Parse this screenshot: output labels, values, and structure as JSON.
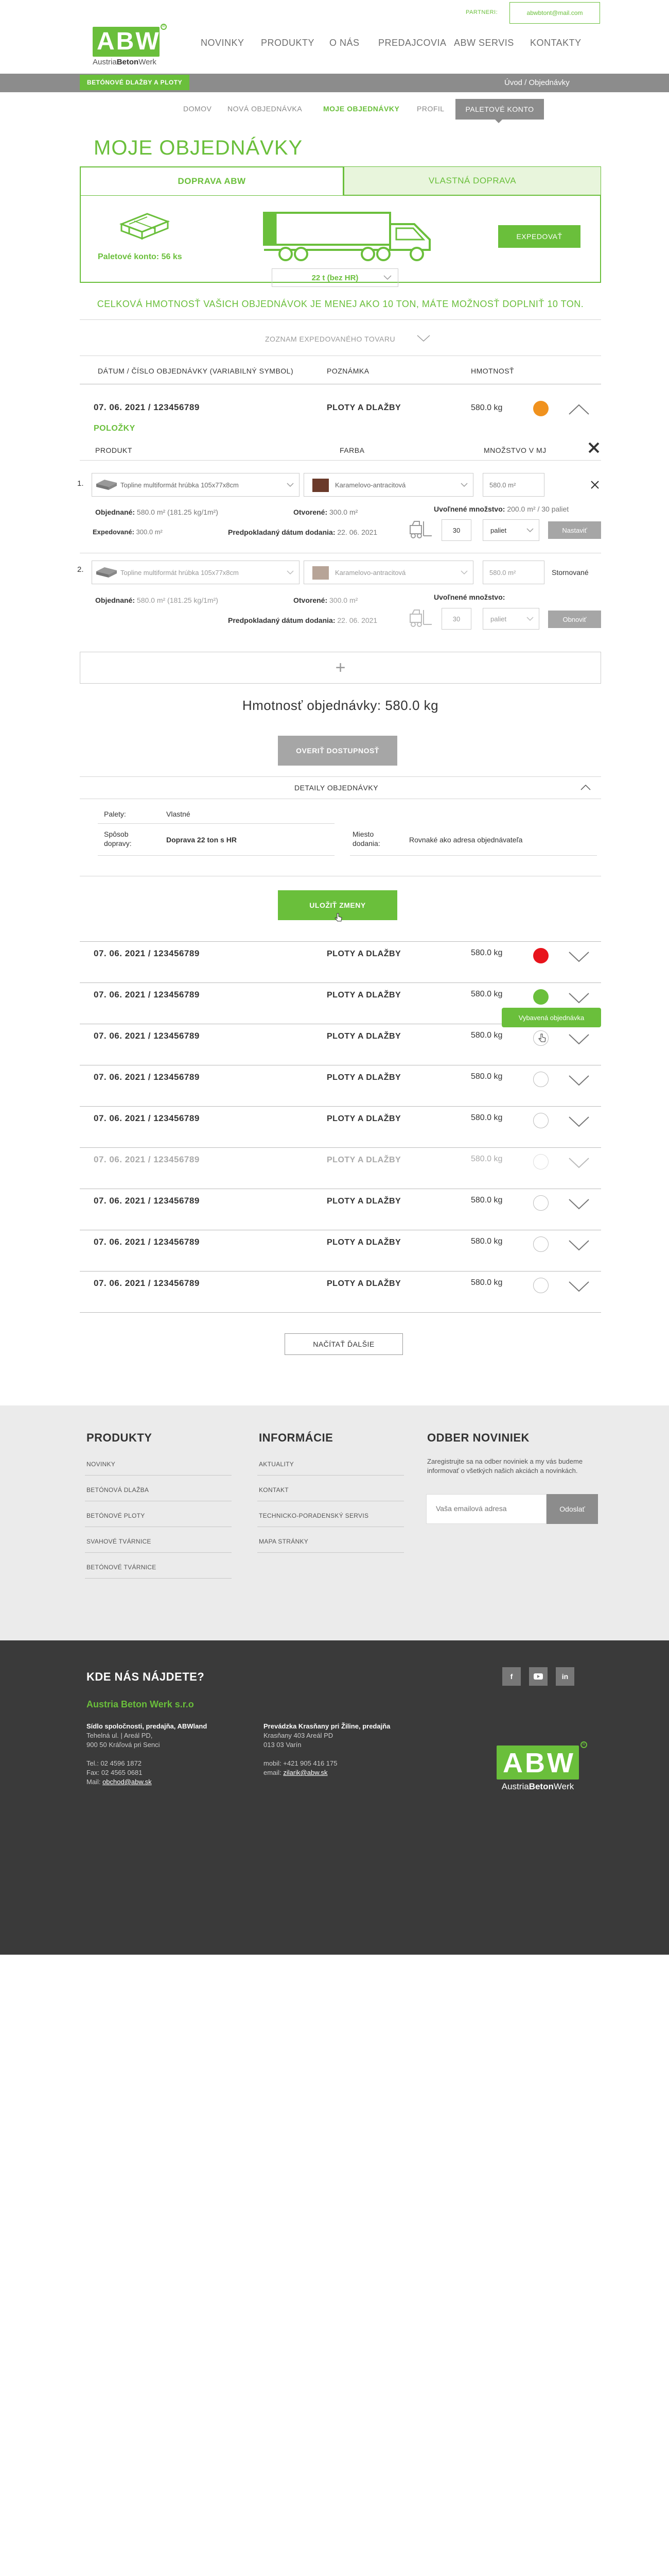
{
  "header": {
    "partner_label": "PARTNERI:",
    "email": "abwbtont@mail.com",
    "logo_text": "ABW",
    "logo_sub_prefix": "Austria",
    "logo_sub_bold": "Beton",
    "logo_sub_suffix": "Werk",
    "nav": [
      "NOVINKY",
      "PRODUKTY",
      "O NÁS",
      "PREDAJCOVIA",
      "ABW SERVIS",
      "KONTAKTY"
    ],
    "breadcrumb_badge": "BETÓNOVÉ DLAŽBY A PLOTY",
    "breadcrumb_right": "Úvod  /  Objednávky"
  },
  "subnav": {
    "items": [
      "DOMOV",
      "NOVÁ OBJEDNÁVKA",
      "MOJE OBJEDNÁVKY",
      "PROFIL"
    ],
    "active_index": 2,
    "button": "PALETOVÉ KONTO"
  },
  "page_title": "MOJE OBJEDNÁVKY",
  "tabs": [
    "DOPRAVA ABW",
    "VLASTNÁ DOPRAVA"
  ],
  "panel": {
    "pallet_label": "Paletové konto: 56 ks",
    "truck_select": "22 t (bez HR)",
    "truck_fill_fraction": 0.1,
    "expedite_button": "EXPEDOVAŤ"
  },
  "info_line": "CELKOVÁ HMOTNOSŤ VAŠICH OBJEDNÁVOK JE MENEJ AKO 10 TON, MÁTE MOŽNOSŤ DOPLNIŤ 10 TON.",
  "expedited_link": "ZOZNAM EXPEDOVANÉHO TOVARU",
  "table_headers": [
    "DÁTUM / ČÍSLO OBJEDNÁVKY (VARIABILNÝ SYMBOL)",
    "POZNÁMKA",
    "HMOTNOSŤ"
  ],
  "expanded_order": {
    "date": "07. 06. 2021 / 123456789",
    "type": "PLOTY A DLAŽBY",
    "weight": "580.0 kg",
    "status_color": "#f0921e",
    "items_label": "POLOŽKY",
    "item_headers": [
      "PRODUKT",
      "FARBA",
      "MNOŽSTVO V MJ"
    ],
    "items": [
      {
        "num": "1.",
        "product": "Topline multiformát hrúbka 105x77x8cm",
        "color_name": "Karamelovo-antracitová",
        "swatch": "#6b3a2a",
        "quantity": "580.0 m²",
        "ordered_label": "Objednané:",
        "ordered_value": "580.0 m² (181.25 kg/1m²)",
        "opened_label": "Otvorené:",
        "opened_value": "300.0 m²",
        "released_label": "Uvoľnené množstvo:",
        "released_value": "200.0 m² / 30 paliet",
        "expedited_label": "Expedované:",
        "expedited_value": "300.0 m²",
        "delivery_label": "Predpokladaný dátum dodania:",
        "delivery_value": "22. 06. 2021",
        "pallet_count": "30",
        "pallet_unit": "paliet",
        "action": "Nastaviť"
      },
      {
        "num": "2.",
        "product": "Topline multiformát hrúbka 105x77x8cm",
        "color_name": "Karamelovo-antracitová",
        "swatch": "#b7a497",
        "quantity": "580.0 m²",
        "status": "Stornované",
        "ordered_label": "Objednané:",
        "ordered_value": "580.0 m² (181.25 kg/1m²)",
        "opened_label": "Otvorené:",
        "opened_value": "300.0 m²",
        "released_label": "Uvoľnené množstvo:",
        "delivery_label": "Predpokladaný dátum dodania:",
        "delivery_value": "22. 06. 2021",
        "pallet_count": "30",
        "pallet_unit": "paliet",
        "action": "Obnoviť"
      }
    ],
    "total_weight": "Hmotnosť objednávky: 580.0 kg",
    "verify_button": "OVERIŤ DOSTUPNOSŤ",
    "details_title": "DETAILY OBJEDNÁVKY",
    "details": {
      "pallets_label": "Palety:",
      "pallets_value": "Vlastné",
      "transport_label": "Spôsob dopravy:",
      "transport_value": "Doprava 22 ton s HR",
      "place_label": "Miesto dodania:",
      "place_value": "Rovnaké ako adresa objednávateľa"
    },
    "save_button": "ULOŽIŤ ZMENY"
  },
  "orders": [
    {
      "date": "07. 06. 2021 / 123456789",
      "type": "PLOTY A DLAŽBY",
      "weight": "580.0 kg",
      "status_color": "#e8141c",
      "faded": false
    },
    {
      "date": "07. 06. 2021 / 123456789",
      "type": "PLOTY A DLAŽBY",
      "weight": "580.0 kg",
      "status_color": "#6abf3b",
      "faded": false
    },
    {
      "date": "07. 06. 2021 / 123456789",
      "type": "PLOTY A DLAŽBY",
      "weight": "580.0 kg",
      "status_color": "",
      "faded": false
    },
    {
      "date": "07. 06. 2021 / 123456789",
      "type": "PLOTY A DLAŽBY",
      "weight": "580.0 kg",
      "status_color": "",
      "faded": false
    },
    {
      "date": "07. 06. 2021 / 123456789",
      "type": "PLOTY A DLAŽBY",
      "weight": "580.0 kg",
      "status_color": "",
      "faded": false
    },
    {
      "date": "07. 06. 2021 / 123456789",
      "type": "PLOTY A DLAŽBY",
      "weight": "580.0 kg",
      "status_color": "",
      "faded": true
    },
    {
      "date": "07. 06. 2021 / 123456789",
      "type": "PLOTY A DLAŽBY",
      "weight": "580.0 kg",
      "status_color": "",
      "faded": false
    },
    {
      "date": "07. 06. 2021 / 123456789",
      "type": "PLOTY A DLAŽBY",
      "weight": "580.0 kg",
      "status_color": "",
      "faded": false
    },
    {
      "date": "07. 06. 2021 / 123456789",
      "type": "PLOTY A DLAŽBY",
      "weight": "580.0 kg",
      "status_color": "",
      "faded": false
    }
  ],
  "tooltip": "Vybavená objednávka",
  "load_more": "NAČÍTAŤ ĎALŠIE",
  "footer": {
    "products_title": "PRODUKTY",
    "products": [
      "NOVINKY",
      "BETÓNOVÁ DLAŽBA",
      "BETÓNOVÉ PLOTY",
      "SVAHOVÉ TVÁRNICE",
      "BETÓNOVÉ TVÁRNICE"
    ],
    "info_title": "INFORMÁCIE",
    "info": [
      "AKTUALITY",
      "KONTAKT",
      "TECHNICKO-PORADENSKÝ SERVIS",
      "MAPA STRÁNKY"
    ],
    "newsletter_title": "ODBER NOVINIEK",
    "newsletter_text": "Zaregistrujte sa na odber noviniek a my vás budeme informovať o všetkých našich akciách a novinkách.",
    "newsletter_placeholder": "Vaša emailová adresa",
    "newsletter_button": "Odoslať",
    "where_title": "KDE NÁS NÁJDETE?",
    "company": "Austria Beton Werk s.r.o",
    "hq_title": "Sídlo spoločnosti, predajňa, ABWland",
    "hq_lines": [
      "Tehelná ul. | Areál PD,",
      "900 50 Kráľová pri Senci"
    ],
    "hq_contact": [
      "Tel.: 02 4596 1872",
      "Fax: 02 4565 0681"
    ],
    "hq_mail_label": "Mail:",
    "hq_mail": "obchod@abw.sk",
    "branch_title": "Prevádzka Krasňany pri Žiline, predajňa",
    "branch_lines": [
      "Krasňany 403 Areál PD",
      "013 03 Varín"
    ],
    "branch_mobile": "mobil: +421 905 416 175",
    "branch_mail_label": "email:",
    "branch_mail": "zilarik@abw.sk",
    "social": [
      "f",
      "y",
      "in"
    ],
    "logo_text": "ABW",
    "logo_sub_prefix": "Austria",
    "logo_sub_bold": "Beton",
    "logo_sub_suffix": "Werk"
  }
}
